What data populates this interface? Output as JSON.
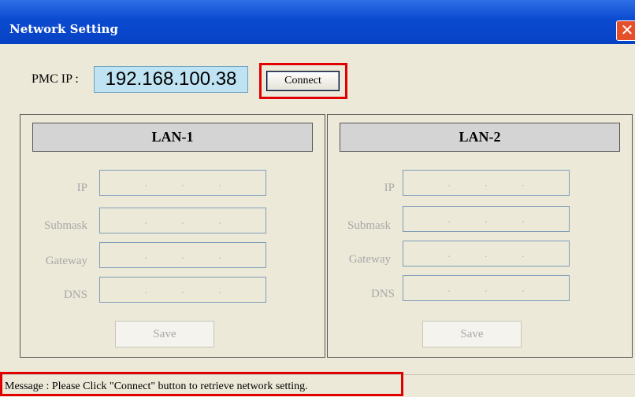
{
  "window": {
    "title": "Network Setting",
    "close_glyph": "✕",
    "close_icon": "close-icon"
  },
  "connection": {
    "label": "PMC IP :",
    "ip": "192.168.100.38",
    "connect_label": "Connect"
  },
  "lan1": {
    "title": "LAN-1",
    "fields": [
      {
        "label": "IP",
        "dots": ". . ."
      },
      {
        "label": "Submask",
        "dots": ". . ."
      },
      {
        "label": "Gateway",
        "dots": ". . ."
      },
      {
        "label": "DNS",
        "dots": ". . ."
      }
    ],
    "save_label": "Save"
  },
  "lan2": {
    "title": "LAN-2",
    "fields": [
      {
        "label": "IP",
        "dots": ". . ."
      },
      {
        "label": "Submask",
        "dots": ". . ."
      },
      {
        "label": "Gateway",
        "dots": ". . ."
      },
      {
        "label": "DNS",
        "dots": ". . ."
      }
    ],
    "save_label": "Save"
  },
  "status": {
    "message": "Message : Please Click \"Connect\" button to retrieve network setting."
  },
  "colors": {
    "titlebar": "#0a4ad0",
    "highlight": "#e10000",
    "ip_bg": "#bfe3f2",
    "disabled_text": "#a8a8a8"
  }
}
